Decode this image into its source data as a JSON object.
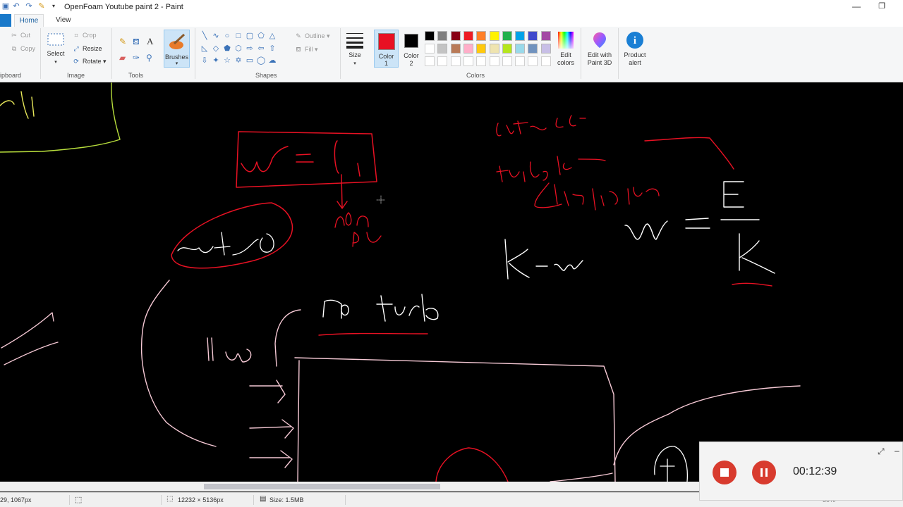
{
  "window": {
    "title": "OpenFoam Youtube paint 2 - Paint",
    "minimize_glyph": "—",
    "restore_glyph": "❐"
  },
  "tabs": {
    "home": "Home",
    "view": "View"
  },
  "ribbon": {
    "clipboard": {
      "cut": "Cut",
      "copy": "Copy",
      "group": "ipboard"
    },
    "image": {
      "select": "Select",
      "crop": "Crop",
      "resize": "Resize",
      "rotate": "Rotate",
      "group": "Image"
    },
    "tools": {
      "group": "Tools"
    },
    "brushes": {
      "label": "Brushes"
    },
    "shapes": {
      "outline": "Outline",
      "fill": "Fill",
      "group": "Shapes"
    },
    "size": {
      "label": "Size"
    },
    "color1": {
      "label_line1": "Color",
      "label_line2": "1",
      "value": "#e81123"
    },
    "color2": {
      "label_line1": "Color",
      "label_line2": "2",
      "value": "#000000"
    },
    "colors": {
      "group": "Colors",
      "row1": [
        "#000000",
        "#7f7f7f",
        "#880015",
        "#ed1c24",
        "#ff7f27",
        "#fff200",
        "#22b14c",
        "#00a2e8",
        "#3f48cc",
        "#a349a4"
      ],
      "row2": [
        "#ffffff",
        "#c3c3c3",
        "#b97a57",
        "#ffaec9",
        "#ffc90e",
        "#efe4b0",
        "#b5e61d",
        "#99d9ea",
        "#7092be",
        "#c8bfe7"
      ],
      "row3": [
        "#ffffff",
        "#ffffff",
        "#ffffff",
        "#ffffff",
        "#ffffff",
        "#ffffff",
        "#ffffff",
        "#ffffff",
        "#ffffff",
        "#ffffff"
      ]
    },
    "edit_colors": {
      "line1": "Edit",
      "line2": "colors"
    },
    "paint3d": {
      "line1": "Edit with",
      "line2": "Paint 3D"
    },
    "product_alert": {
      "line1": "Product",
      "line2": "alert"
    }
  },
  "status": {
    "cursor_pos": "29, 1067px",
    "selection_size": "12232 × 5136px",
    "file_size": "Size: 1.5MB",
    "zoom": "50%"
  },
  "recorder": {
    "time": "00:12:39"
  },
  "icons": [
    "cut-icon",
    "copy-icon",
    "crop-icon",
    "resize-icon",
    "rotate-icon",
    "pencil-icon",
    "fill-icon",
    "text-icon",
    "eraser-icon",
    "color-picker-icon",
    "magnifier-icon",
    "brush-icon",
    "size-icon",
    "palette-icon",
    "paint3d-icon",
    "info-icon",
    "undo-icon",
    "redo-icon",
    "save-icon",
    "stop-icon",
    "pause-icon",
    "expand-icon"
  ]
}
